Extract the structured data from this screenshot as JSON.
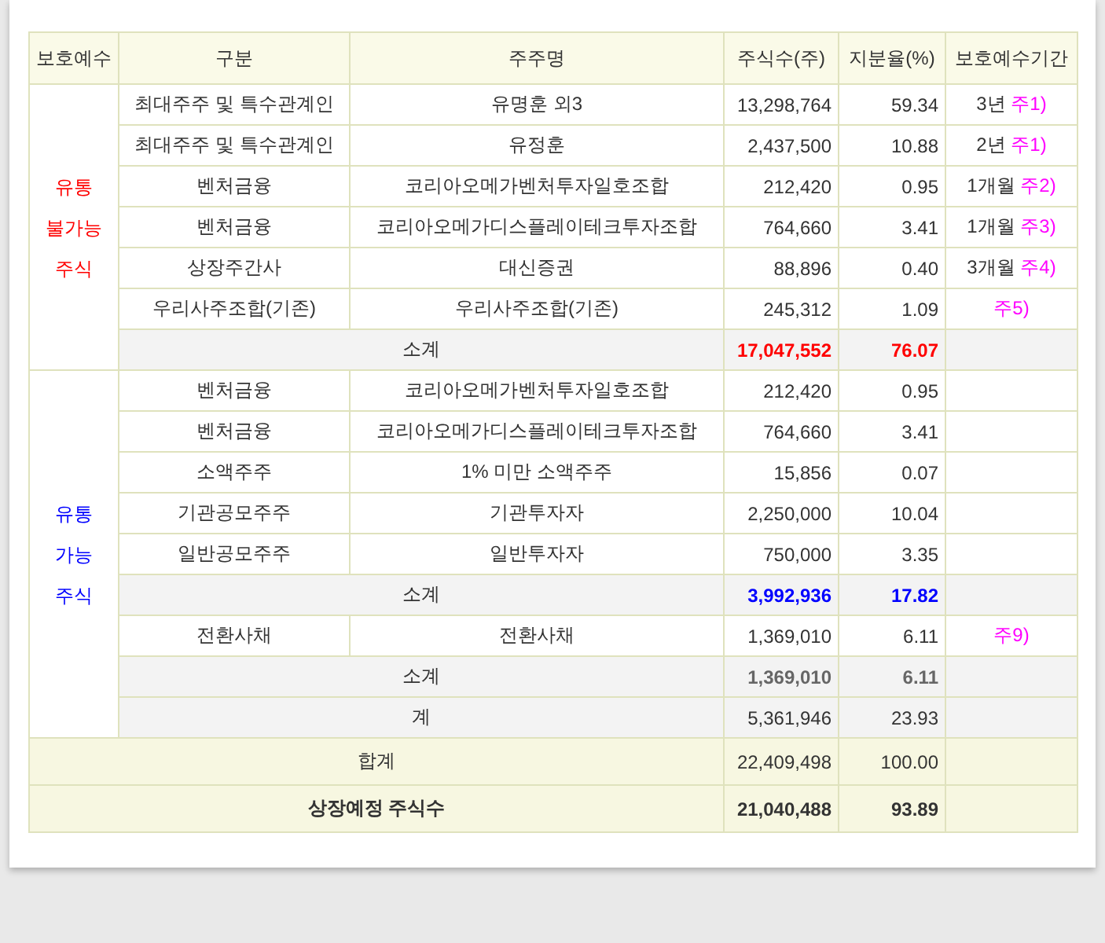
{
  "table": {
    "columns": [
      "보호예수",
      "구분",
      "주주명",
      "주식수(주)",
      "지분율(%)",
      "보호예수기간"
    ],
    "groups": [
      {
        "label_lines": [
          "유통",
          "불가능",
          "주식"
        ],
        "color": "#ff0000",
        "rows": [
          {
            "kind": "item",
            "category": "최대주주 및 특수관계인",
            "holder": "유명훈 외3",
            "shares": "13,298,764",
            "ratio": "59.34",
            "period": "3년",
            "note": "주1)"
          },
          {
            "kind": "item",
            "category": "최대주주 및 특수관계인",
            "holder": "유정훈",
            "shares": "2,437,500",
            "ratio": "10.88",
            "period": "2년",
            "note": "주1)"
          },
          {
            "kind": "item",
            "category": "벤처금융",
            "holder": "코리아오메가벤처투자일호조합",
            "shares": "212,420",
            "ratio": "0.95",
            "period": "1개월",
            "note": "주2)"
          },
          {
            "kind": "item",
            "category": "벤처금융",
            "holder": "코리아오메가디스플레이테크투자조합",
            "shares": "764,660",
            "ratio": "3.41",
            "period": "1개월",
            "note": "주3)"
          },
          {
            "kind": "item",
            "category": "상장주간사",
            "holder": "대신증권",
            "shares": "88,896",
            "ratio": "0.40",
            "period": "3개월",
            "note": "주4)"
          },
          {
            "kind": "item",
            "category": "우리사주조합(기존)",
            "holder": "우리사주조합(기존)",
            "shares": "245,312",
            "ratio": "1.09",
            "note": "주5)"
          },
          {
            "kind": "subtotal",
            "label": "소계",
            "shares": "17,047,552",
            "ratio": "76.07",
            "color": "#ff0000",
            "bold": true
          }
        ]
      },
      {
        "label_lines": [
          "유통",
          "가능",
          "주식"
        ],
        "color": "#0000ff",
        "rows": [
          {
            "kind": "item",
            "category": "벤처금융",
            "holder": "코리아오메가벤처투자일호조합",
            "shares": "212,420",
            "ratio": "0.95"
          },
          {
            "kind": "item",
            "category": "벤처금융",
            "holder": "코리아오메가디스플레이테크투자조합",
            "shares": "764,660",
            "ratio": "3.41"
          },
          {
            "kind": "item",
            "category": "소액주주",
            "holder": "1% 미만 소액주주",
            "shares": "15,856",
            "ratio": "0.07"
          },
          {
            "kind": "item",
            "category": "기관공모주주",
            "holder": "기관투자자",
            "shares": "2,250,000",
            "ratio": "10.04"
          },
          {
            "kind": "item",
            "category": "일반공모주주",
            "holder": "일반투자자",
            "shares": "750,000",
            "ratio": "3.35"
          },
          {
            "kind": "subtotal",
            "label": "소계",
            "shares": "3,992,936",
            "ratio": "17.82",
            "color": "#0000ff",
            "bold": true
          },
          {
            "kind": "item",
            "category": "전환사채",
            "holder": "전환사채",
            "shares": "1,369,010",
            "ratio": "6.11",
            "note": "주9)"
          },
          {
            "kind": "subtotal",
            "label": "소계",
            "shares": "1,369,010",
            "ratio": "6.11",
            "color": "#666666",
            "bold": true
          },
          {
            "kind": "subtotal",
            "label": "계",
            "shares": "5,361,946",
            "ratio": "23.93",
            "color": "#333333",
            "bold": false
          }
        ]
      }
    ],
    "footer": [
      {
        "label": "합계",
        "shares": "22,409,498",
        "ratio": "100.00",
        "bold": false
      },
      {
        "label": "상장예정 주식수",
        "shares": "21,040,488",
        "ratio": "93.89",
        "bold": true
      }
    ]
  }
}
